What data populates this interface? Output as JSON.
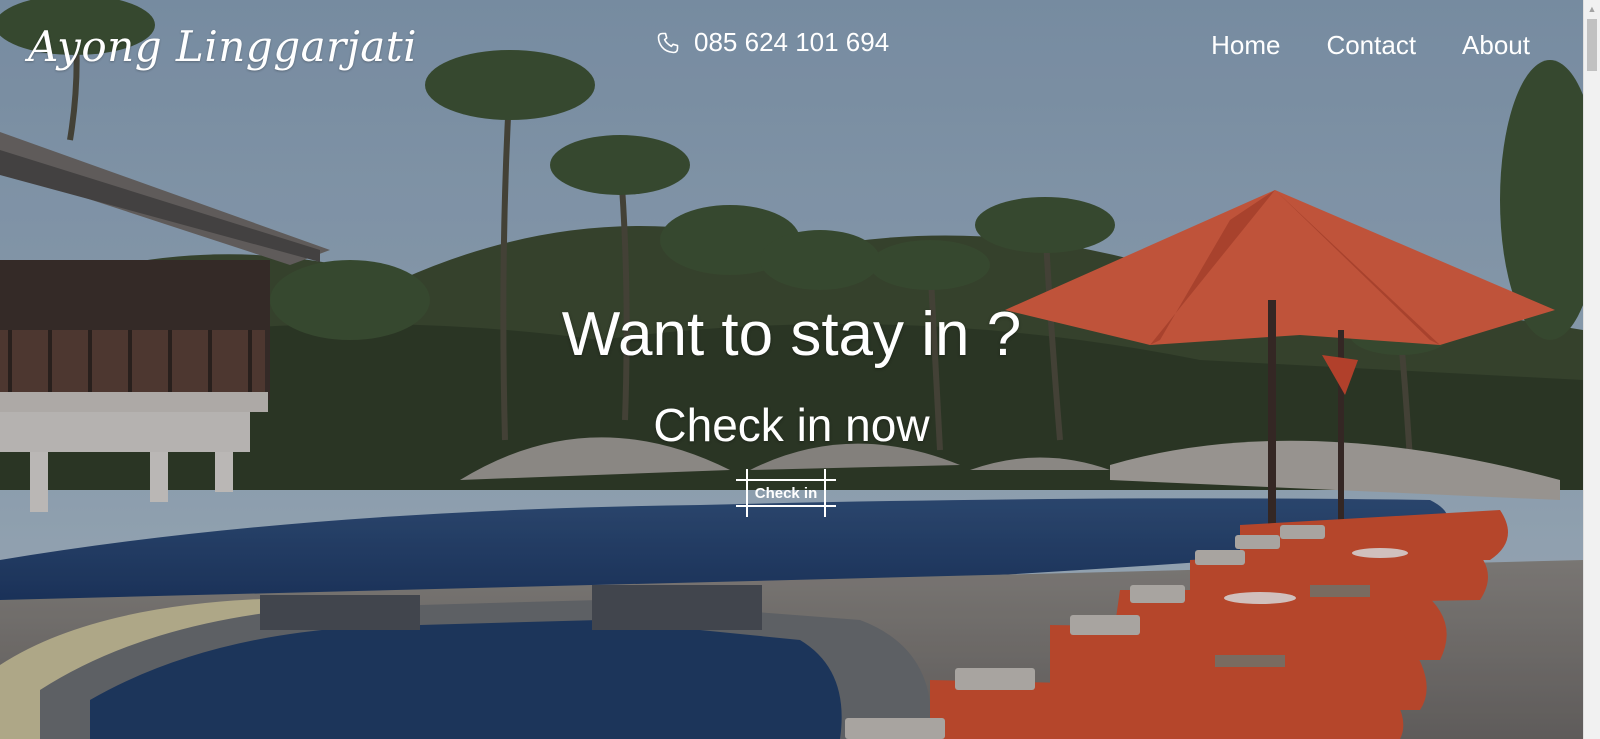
{
  "header": {
    "logo_text": "Ayong Linggarjati",
    "phone_icon": "phone-icon",
    "phone_number": "085 624 101 694",
    "nav": [
      {
        "label": "Home"
      },
      {
        "label": "Contact"
      },
      {
        "label": "About"
      }
    ]
  },
  "hero": {
    "title": "Want to stay in ?",
    "subtitle": "Check in now",
    "button_label": "Check in"
  },
  "colors": {
    "text": "#ffffff",
    "sky": "#7f9ab4",
    "pool": "#1f3e6c",
    "umbrella": "#e4603f",
    "cushion": "#d8502d"
  },
  "scrollbar": {
    "up_icon": "chevron-up-icon"
  }
}
